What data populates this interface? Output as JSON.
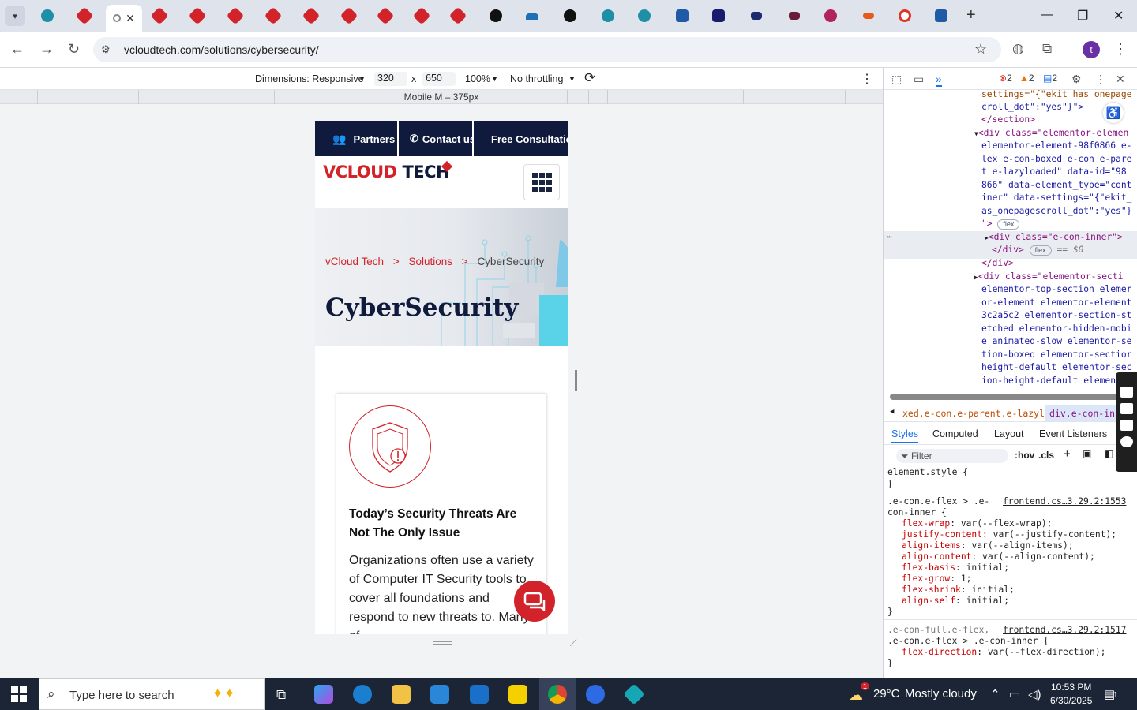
{
  "browser": {
    "url": "vcloudtech.com/solutions/cybersecurity/",
    "new_tab_label": "+",
    "minimize": "—",
    "maximize": "❐",
    "close": "✕",
    "profile_initial": "t"
  },
  "device_toolbar": {
    "dimensions_label": "Dimensions: Responsive",
    "width": "320",
    "height": "650",
    "zoom": "100%",
    "throttling": "No throttling",
    "times": "x"
  },
  "ruler": {
    "device_label": "Mobile M – 375px"
  },
  "site": {
    "nav": [
      "Partners",
      "Contact us",
      "Free Consultation"
    ],
    "logo_v": "V",
    "logo_cloud": "CLOUD ",
    "logo_tech": "TECH",
    "breadcrumb": [
      "vCloud Tech",
      ">",
      "Solutions",
      ">",
      "CyberSecurity"
    ],
    "hero_title": "CyberSecurity",
    "card_title": "Today’s Security Threats Are Not The Only Issue",
    "card_body": "Organizations often use a variety of Computer IT Security tools to cover all foundations and respond to new threats to. Many of",
    "accent": "#d2232a",
    "navy": "#0f1a3c"
  },
  "devtools": {
    "errors": "2",
    "warnings": "2",
    "issues": "2",
    "elements_lines": [
      "settings=\"{\"ekit_has_onepage",
      "croll_dot\":\"yes\"}\">",
      "</section>",
      "<div class=\"elementor-elemen",
      "elementor-element-98f0866 e-",
      "lex e-con-boxed e-con e-pare",
      "t e-lazyloaded\" data-id=\"98",
      "866\" data-element_type=\"cont",
      "iner\" data-settings=\"{\"ekit_",
      "as_onepagescroll_dot\":\"yes\"}",
      "\">",
      "<div class=\"e-con-inner\">",
      "</div>",
      "</div>",
      "<div class=\"elementor-secti",
      "elementor-top-section elemer",
      "or-element elementor-element",
      "3c2a5c2 elementor-section-st",
      "etched elementor-hidden-mobi",
      "e animated-slow elementor-se",
      "tion-boxed elementor-sectior",
      "height-default elementor-sec",
      "ion-height-default element"
    ],
    "badge_flex": "flex",
    "eq_so": "== $0",
    "crumb1": "xed.e-con.e-parent.e-lazyloaded",
    "crumb2": "div.e-con-inner",
    "tabs": [
      "Styles",
      "Computed",
      "Layout",
      "Event Listeners"
    ],
    "filter_placeholder": "Filter",
    "hov": ":hov",
    "cls": ".cls",
    "styles": {
      "element_style": "element.style {",
      "close": "}",
      "rule1_selector_a": ".e-con.e-flex > .e-",
      "rule1_selector_b": "con-inner {",
      "rule1_source": "frontend.cs…3.29.2:1553",
      "rule1_props": [
        [
          "flex-wrap",
          "var(--flex-wrap);"
        ],
        [
          "justify-content",
          "var(--justify-content);"
        ],
        [
          "align-items",
          "var(--align-items);"
        ],
        [
          "align-content",
          "var(--align-content);"
        ],
        [
          "flex-basis",
          "initial;"
        ],
        [
          "flex-grow",
          "1;"
        ],
        [
          "flex-shrink",
          "initial;"
        ],
        [
          "align-self",
          "initial;"
        ]
      ],
      "rule2_selector_a": ".e-con-full.e-flex,",
      "rule2_selector_b": ".e-con.e-flex > .e-con-inner {",
      "rule2_source": "frontend.cs…3.29.2:1517",
      "rule2_props": [
        [
          "flex-direction",
          "var(--flex-direction);"
        ]
      ]
    }
  },
  "taskbar": {
    "search_placeholder": "Type here to search",
    "weather_temp": "29°C",
    "weather_text": "Mostly cloudy",
    "time": "10:53 PM",
    "date": "6/30/2025",
    "weather_badge": "1",
    "notif_count": "1"
  }
}
